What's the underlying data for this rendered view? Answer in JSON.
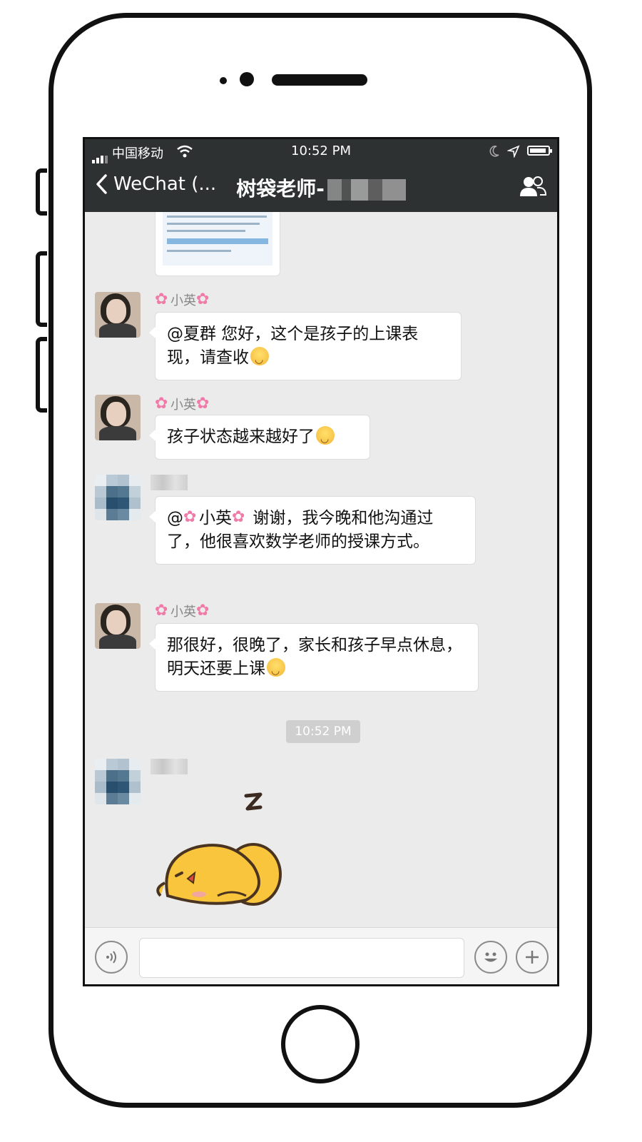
{
  "status_bar": {
    "carrier": "中国移动",
    "time": "10:52 PM"
  },
  "nav": {
    "back_label": "WeChat (...",
    "title": "树袋老师-"
  },
  "messages": [
    {
      "sender": "小英",
      "text": "@夏群 您好，这个是孩子的上课表现，请查收"
    },
    {
      "sender": "小英",
      "text": "孩子状态越来越好了"
    },
    {
      "sender": "",
      "text_prefix": "@",
      "mention": "小英",
      "text": "谢谢，我今晚和他沟通过了，他很喜欢数学老师的授课方式。"
    },
    {
      "sender": "小英",
      "text": "那很好，很晚了，家长和孩子早点休息，明天还要上课"
    }
  ],
  "timestamp": "10:52 PM",
  "icons": {
    "back": "chevron-left-icon",
    "members": "group-members-icon",
    "voice": "voice-input-icon",
    "emoji": "emoji-icon",
    "more": "plus-icon"
  }
}
